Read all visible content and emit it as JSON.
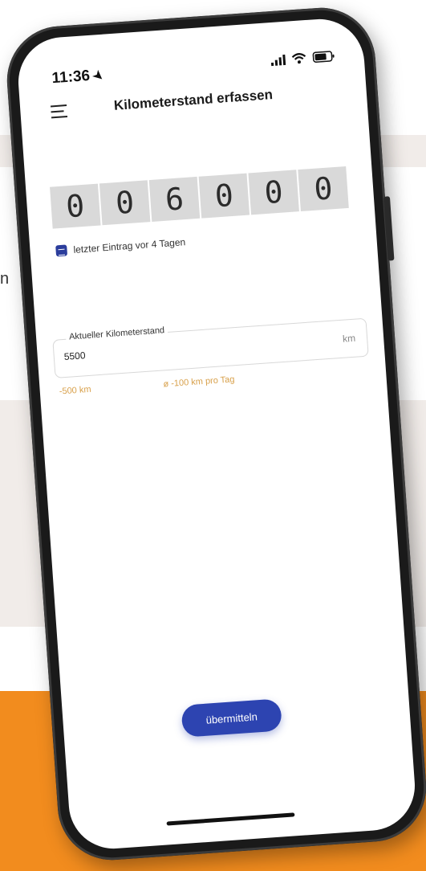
{
  "background": {
    "edge_letter": "n",
    "colors": {
      "grey": "#f1ece9",
      "orange": "#f28c1e"
    }
  },
  "status_bar": {
    "time": "11:36",
    "icons": [
      "location-arrow-icon",
      "signal-icon",
      "wifi-icon",
      "battery-icon"
    ]
  },
  "header": {
    "title": "Kilometerstand erfassen",
    "menu_icon": "hamburger-menu-icon"
  },
  "odometer": {
    "digits": [
      "0",
      "0",
      "6",
      "0",
      "0",
      "0"
    ]
  },
  "last_entry": {
    "text": "letzter Eintrag vor 4 Tagen",
    "icon": "calendar-icon"
  },
  "km_input": {
    "label": "Aktueller Kilometerstand",
    "value": "5500",
    "unit": "km"
  },
  "difference": {
    "km": "-500 km",
    "per_day": "ø -100 km pro Tag"
  },
  "submit": {
    "label": "übermitteln"
  },
  "colors": {
    "accent": "#2d44b1",
    "warning_text": "#d8a04a",
    "digit_bg": "#d9d9d9"
  }
}
